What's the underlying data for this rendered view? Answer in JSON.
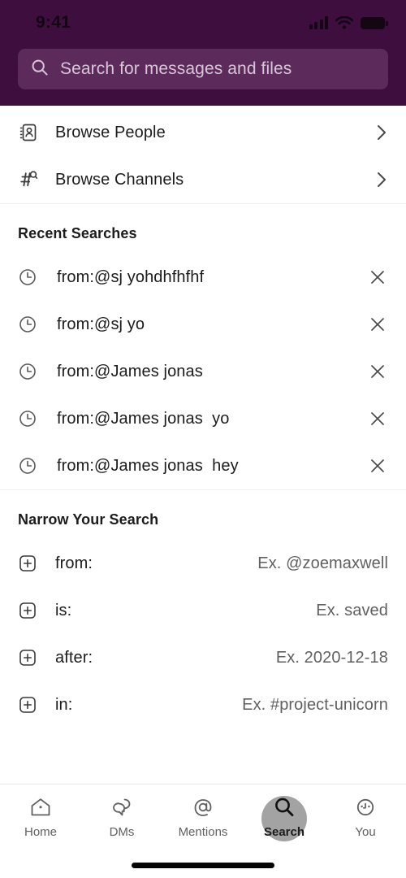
{
  "status_bar": {
    "time": "9:41",
    "icons": [
      "signal-bars-icon",
      "wifi-icon",
      "battery-icon"
    ]
  },
  "header": {
    "background_color": "#3E0E3E",
    "search": {
      "icon": "search-icon",
      "placeholder": "Search for messages and files",
      "value": ""
    }
  },
  "browse": [
    {
      "icon": "contact-card-icon",
      "label": "Browse People",
      "accessory": "chevron-right-icon"
    },
    {
      "icon": "hash-search-icon",
      "label": "Browse Channels",
      "accessory": "chevron-right-icon"
    }
  ],
  "recent": {
    "title": "Recent Searches",
    "row_icon": "clock-icon",
    "remove_icon": "close-icon",
    "items": [
      {
        "query": "from:@sj yohdhfhfhf"
      },
      {
        "query": "from:@sj yo"
      },
      {
        "query": "from:@James jonas"
      },
      {
        "query": "from:@James jonas  yo"
      },
      {
        "query": "from:@James jonas  hey"
      }
    ]
  },
  "narrow": {
    "title": "Narrow Your Search",
    "row_icon": "plus-box-icon",
    "items": [
      {
        "key": "from:",
        "example": "Ex. @zoemaxwell"
      },
      {
        "key": "is:",
        "example": "Ex. saved"
      },
      {
        "key": "after:",
        "example": "Ex. 2020-12-18"
      },
      {
        "key": "in:",
        "example": "Ex. #project-unicorn"
      }
    ]
  },
  "tabbar": {
    "items": [
      {
        "icon": "home-icon",
        "label": "Home",
        "active": false
      },
      {
        "icon": "dm-icon",
        "label": "DMs",
        "active": false
      },
      {
        "icon": "mentions-icon",
        "label": "Mentions",
        "active": false
      },
      {
        "icon": "search-icon",
        "label": "Search",
        "active": true
      },
      {
        "icon": "avatar-icon",
        "label": "You",
        "active": false
      }
    ]
  }
}
